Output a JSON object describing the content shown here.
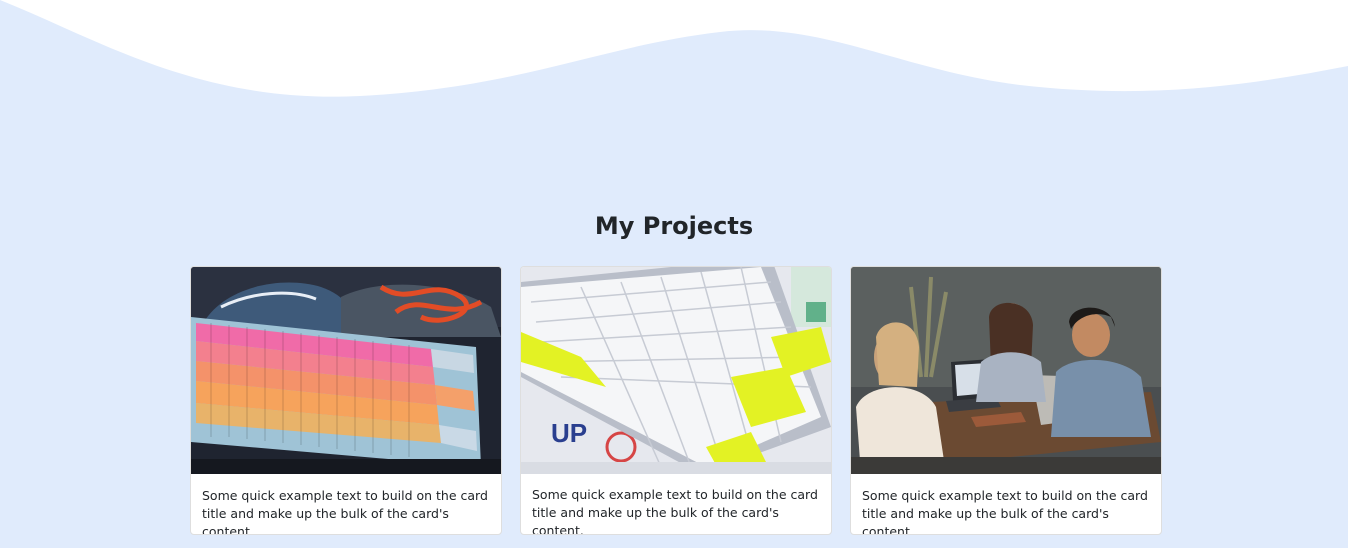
{
  "section": {
    "title": "My Projects",
    "background_color": "#e0ebfc"
  },
  "cards": [
    {
      "image_icon": "keyboard-pastel-with-sneakers-photo",
      "text": "Some quick example text to build on the card title and make up the bulk of the card's content."
    },
    {
      "image_icon": "keyboard-white-yellow-photo",
      "text": "Some quick example text to build on the card title and make up the bulk of the card's content."
    },
    {
      "image_icon": "team-meeting-laptops-photo",
      "text": "Some quick example text to build on the card title and make up the bulk of the card's content."
    }
  ]
}
